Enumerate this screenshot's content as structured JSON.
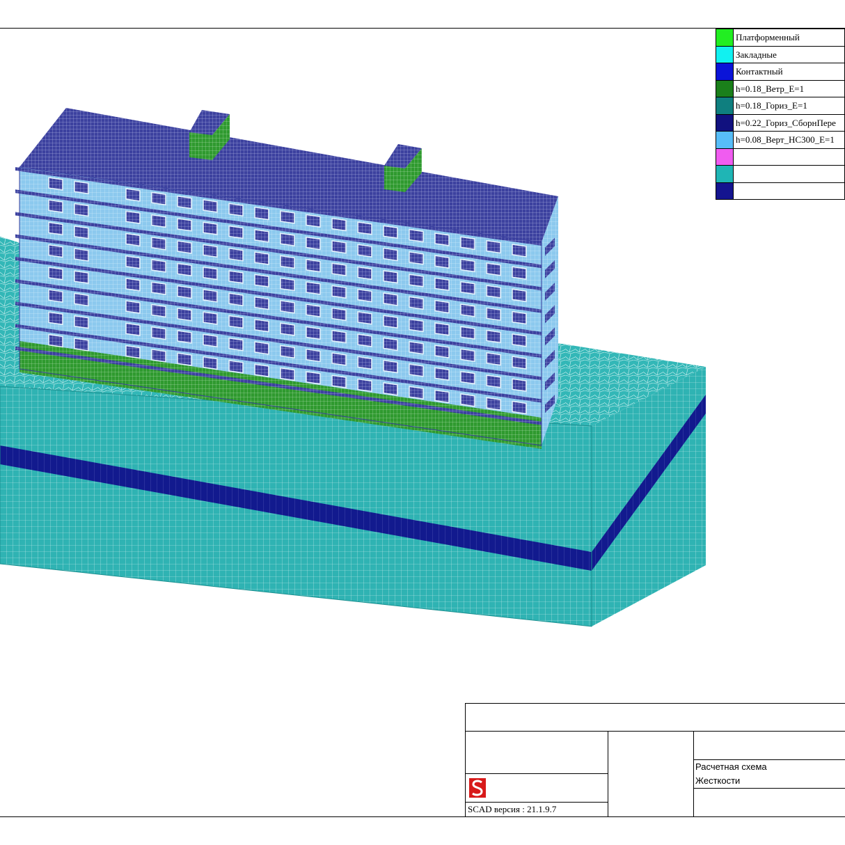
{
  "legend": {
    "items": [
      {
        "label": "Платформенный",
        "color": "#22ee22"
      },
      {
        "label": "Закладные",
        "color": "#11f1f1"
      },
      {
        "label": "Контактный",
        "color": "#0a14d8"
      },
      {
        "label": "h=0.18_Ветр_E=1",
        "color": "#1a7f1a"
      },
      {
        "label": "h=0.18_Гориз_E=1",
        "color": "#0f7f7f"
      },
      {
        "label": "h=0.22_Гориз_СборнПере",
        "color": "#11117f"
      },
      {
        "label": "h=0.08_Верт_НС300_E=1",
        "color": "#57bdf8"
      },
      {
        "label": "",
        "color": "#f05cf0"
      },
      {
        "label": "",
        "color": "#1fb5b5"
      },
      {
        "label": "",
        "color": "#14148f"
      }
    ]
  },
  "title_block": {
    "line1": "Расчетная схема",
    "line2": "Жесткости",
    "version": "SCAD версия : 21.1.9.7"
  },
  "colors": {
    "soil": "#2fb3b3",
    "soil_dark": "#1f9a9a",
    "soil_layer": "#121a8e",
    "wall": "#8cc9ee",
    "slab": "#3a3f9e",
    "base_green": "#2f9a2f",
    "roof": "#4a4fb0"
  }
}
